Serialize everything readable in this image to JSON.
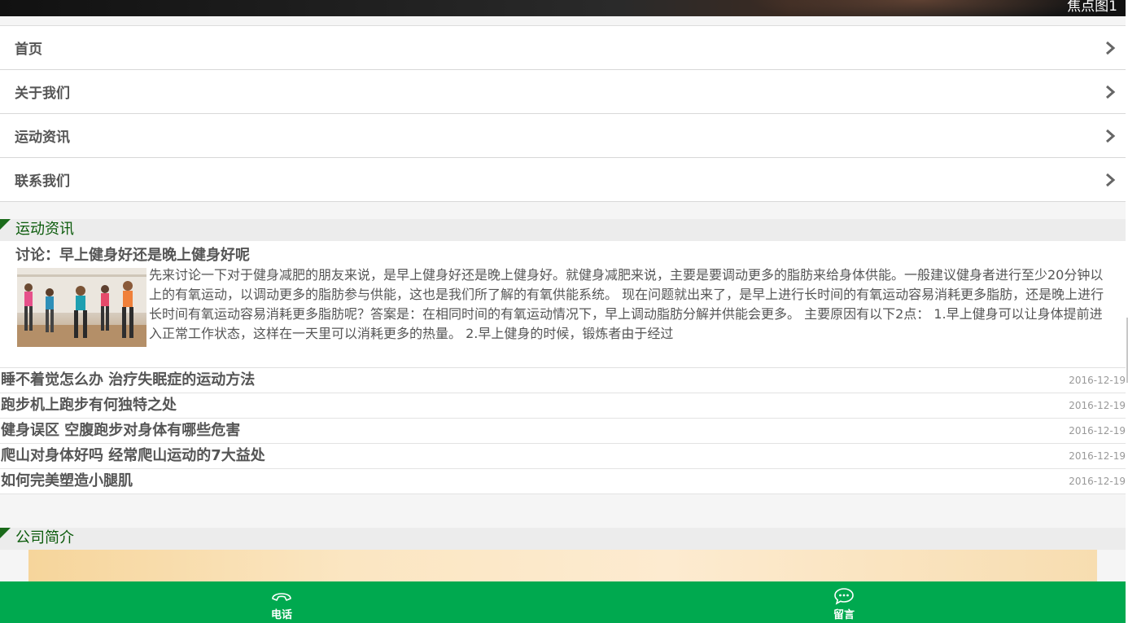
{
  "banner": {
    "caption": "焦点图1"
  },
  "nav": {
    "items": [
      {
        "label": "首页"
      },
      {
        "label": "关于我们"
      },
      {
        "label": "运动资讯"
      },
      {
        "label": "联系我们"
      }
    ]
  },
  "news_section": {
    "title": "运动资讯",
    "featured": {
      "title": "讨论：早上健身好还是晚上健身好呢",
      "excerpt": "先来讨论一下对于健身减肥的朋友来说，是早上健身好还是晚上健身好。就健身减肥来说，主要是要调动更多的脂肪来给身体供能。一般建议健身者进行至少20分钟以上的有氧运动，以调动更多的脂肪参与供能，这也是我们所了解的有氧供能系统。 现在问题就出来了，是早上进行长时间的有氧运动容易消耗更多脂肪，还是晚上进行长时间有氧运动容易消耗更多脂肪呢？答案是：在相同时间的有氧运动情况下，早上调动脂肪分解并供能会更多。 主要原因有以下2点： 1.早上健身可以让身体提前进入正常工作状态，这样在一天里可以消耗更多的热量。 2.早上健身的时候，锻炼者由于经过"
    },
    "list": [
      {
        "title": "睡不着觉怎么办 治疗失眠症的运动方法",
        "date": "2016-12-19"
      },
      {
        "title": "跑步机上跑步有何独特之处",
        "date": "2016-12-19"
      },
      {
        "title": "健身误区 空腹跑步对身体有哪些危害",
        "date": "2016-12-19"
      },
      {
        "title": "爬山对身体好吗 经常爬山运动的7大益处",
        "date": "2016-12-19"
      },
      {
        "title": "如何完美塑造小腿肌",
        "date": "2016-12-19"
      }
    ]
  },
  "company_section": {
    "title": "公司简介"
  },
  "footer": {
    "phone_label": "电话",
    "message_label": "留言",
    "icons": {
      "phone": "phone-icon",
      "message": "chat-bubble-icon"
    }
  },
  "colors": {
    "accent_green": "#00a94f",
    "section_title": "#0a5a0a"
  }
}
